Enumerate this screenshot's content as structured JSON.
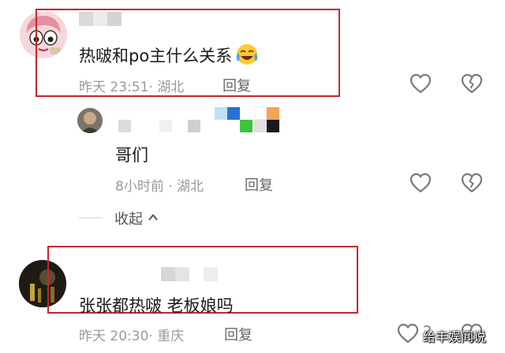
{
  "comments": [
    {
      "text": "热啵和po主什么关系",
      "time": "昨天 23:51",
      "location": "湖北",
      "reply_label": "回复",
      "emoji": "face-with-tears-of-joy",
      "reply": {
        "text": "哥们",
        "time": "8小时前",
        "location": "湖北",
        "reply_label": "回复"
      },
      "collapse_label": "收起"
    },
    {
      "text": "张张都热啵 老板娘吗",
      "time": "昨天 20:30",
      "location": "重庆",
      "reply_label": "回复",
      "like_count": "2"
    }
  ],
  "meta_sep": "·",
  "watermark": "给丰娱闻说",
  "colors": {
    "highlight_border": "#c0282d",
    "meta_gray": "#999999",
    "icon_gray": "#7a7a7a"
  }
}
